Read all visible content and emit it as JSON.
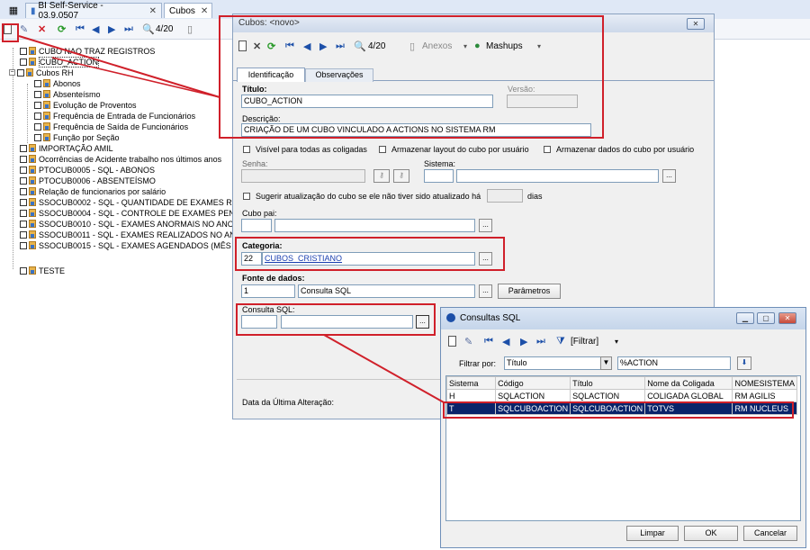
{
  "tabs": [
    {
      "label": "BI Self-Service - 03.9.0507"
    },
    {
      "label": "Cubos"
    }
  ],
  "main_toolbar": {
    "record_counter": "4/20"
  },
  "tree": [
    {
      "label": "CUBO NAO TRAZ REGISTROS",
      "level": 1
    },
    {
      "label": "CUBO_ACTION",
      "level": 1
    },
    {
      "label": "Cubos RH",
      "level": 1
    },
    {
      "label": "Abonos",
      "level": 2
    },
    {
      "label": "Absenteísmo",
      "level": 2
    },
    {
      "label": "Evolução de Proventos",
      "level": 2
    },
    {
      "label": "Frequência de Entrada de Funcionários",
      "level": 2
    },
    {
      "label": "Frequência de Saída de Funcionários",
      "level": 2
    },
    {
      "label": "Função por Seção",
      "level": 2
    },
    {
      "label": "IMPORTAÇÃO AMIL",
      "level": 1
    },
    {
      "label": "Ocorrências de Acidente trabalho nos últimos anos",
      "level": 1
    },
    {
      "label": "PTOCUB0005 - SQL - ABONOS",
      "level": 1
    },
    {
      "label": "PTOCUB0006 - ABSENTEÍSMO",
      "level": 1
    },
    {
      "label": "Relação de funcionarios por salário",
      "level": 1
    },
    {
      "label": "SSOCUB0002 - SQL - QUANTIDADE DE EXAMES RE",
      "level": 1
    },
    {
      "label": "SSOCUB0004 - SQL - CONTROLE DE EXAMES PEN",
      "level": 1
    },
    {
      "label": "SSOCUB0010 - SQL - EXAMES ANORMAIS NO ANO",
      "level": 1
    },
    {
      "label": "SSOCUB0011 - SQL - EXAMES REALIZADOS NO AN",
      "level": 1
    },
    {
      "label": "SSOCUB0015 - SQL - EXAMES AGENDADOS (MÊS",
      "level": 1
    },
    {
      "label": "TESTE",
      "level": 1
    }
  ],
  "dialog": {
    "title": "Cubos: <novo>",
    "toolbar": {
      "record_counter": "4/20",
      "anexos_label": "Anexos",
      "mashups_label": "Mashups"
    },
    "tabs": [
      "Identificação",
      "Observações"
    ],
    "titulo_label": "Título:",
    "titulo_value": "CUBO_ACTION",
    "versao_label": "Versão:",
    "descricao_label": "Descrição:",
    "descricao_value": "CRIAÇÃO DE UM CUBO VINCULADO A ACTIONS NO SISTEMA RM",
    "check_visivel": "Visível para  todas as coligadas",
    "check_layout": "Armazenar layout do cubo por usuário",
    "check_dados": "Armazenar dados do cubo por usuário",
    "senha_label": "Senha:",
    "sistema_label": "Sistema:",
    "check_sugerir": "Sugerir atualização do cubo se ele não tiver sido atualizado há",
    "dias_label": "dias",
    "cubo_pai_label": "Cubo pai:",
    "categoria_label": "Categoria:",
    "categoria_code": "22",
    "categoria_value": "CUBOS_CRISTIANO",
    "fonte_label": "Fonte de dados:",
    "fonte_code": "1",
    "fonte_value": "Consulta SQL",
    "parametros_label": "Parâmetros",
    "consulta_label": "Consulta SQL:",
    "ultima_alteracao_label": "Data da Última Alteração:",
    "ellipsis": "..."
  },
  "consultas": {
    "title": "Consultas SQL",
    "filtrar_label": "[Filtrar]",
    "filtrar_por_label": "Filtrar por:",
    "filtrar_por_value": "Título",
    "filter_text": "%ACTION",
    "columns": [
      "Sistema",
      "Código",
      "Título",
      "Nome da Coligada",
      "NOMESISTEMA"
    ],
    "rows": [
      [
        "H",
        "SQLACTION",
        "SQLACTION",
        "COLIGADA GLOBAL",
        "RM AGILIS"
      ],
      [
        "T",
        "SQLCUBOACTION",
        "SQLCUBOACTION",
        "TOTVS",
        "RM NUCLEUS"
      ]
    ],
    "selected_row": 1,
    "limpar": "Limpar",
    "ok": "OK",
    "cancelar": "Cancelar"
  },
  "colors": {
    "highlight": "#d0202a",
    "selection": "#0a246a"
  }
}
